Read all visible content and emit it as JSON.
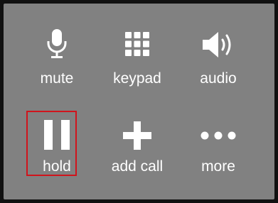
{
  "buttons": {
    "mute": {
      "label": "mute",
      "icon": "microphone-icon"
    },
    "keypad": {
      "label": "keypad",
      "icon": "keypad-grid-icon"
    },
    "audio": {
      "label": "audio",
      "icon": "speaker-icon"
    },
    "hold": {
      "label": "hold",
      "icon": "pause-icon"
    },
    "add_call": {
      "label": "add call",
      "icon": "plus-icon"
    },
    "more": {
      "label": "more",
      "icon": "ellipsis-icon"
    }
  },
  "colors": {
    "background": "#818181",
    "outer_border": "#111111",
    "foreground": "#ffffff",
    "highlight": "#d0141c"
  }
}
